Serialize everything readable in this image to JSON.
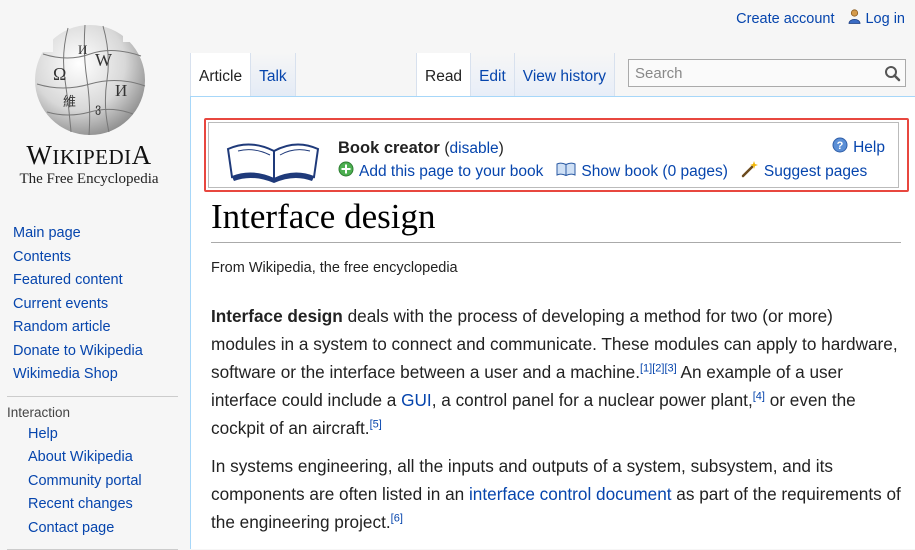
{
  "personal": {
    "create_account": "Create account",
    "login": "Log in"
  },
  "logo": {
    "wordmark_first": "W",
    "wordmark_rest": "IKIPEDI",
    "wordmark_last": "A",
    "tagline": "The Free Encyclopedia"
  },
  "sidebar": {
    "main_items": [
      {
        "label": "Main page"
      },
      {
        "label": "Contents"
      },
      {
        "label": "Featured content"
      },
      {
        "label": "Current events"
      },
      {
        "label": "Random article"
      },
      {
        "label": "Donate to Wikipedia"
      },
      {
        "label": "Wikimedia Shop"
      }
    ],
    "interaction_heading": "Interaction",
    "interaction_items": [
      {
        "label": "Help"
      },
      {
        "label": "About Wikipedia"
      },
      {
        "label": "Community portal"
      },
      {
        "label": "Recent changes"
      },
      {
        "label": "Contact page"
      }
    ]
  },
  "tabs": {
    "article": "Article",
    "talk": "Talk",
    "read": "Read",
    "edit": "Edit",
    "view_history": "View history"
  },
  "search": {
    "placeholder": "Search"
  },
  "book_creator": {
    "title": "Book creator",
    "disable_open": "(",
    "disable": "disable",
    "disable_close": ")",
    "help": "Help",
    "add_page": "Add this page to your book",
    "show_book": "Show book (0 pages)",
    "suggest": "Suggest pages"
  },
  "article": {
    "title": "Interface design",
    "tagline": "From Wikipedia, the free encyclopedia",
    "p1": {
      "bold": "Interface design",
      "t1": " deals with the process of developing a method for two (or more) modules in a system to connect and communicate. These modules can apply to hardware, software or the interface between a user and a machine.",
      "ref1": "[1]",
      "ref2": "[2]",
      "ref3": "[3]",
      "t2": " An example of a user interface could include a ",
      "gui": "GUI",
      "t3": ", a control panel for a nuclear power plant,",
      "ref4": "[4]",
      "t4": " or even the cockpit of an aircraft.",
      "ref5": "[5]"
    },
    "p2": {
      "t1": "In systems engineering, all the inputs and outputs of a system, subsystem, and its components are often listed in an ",
      "icd": "interface control document",
      "t2": " as part of the requirements of the engineering project.",
      "ref6": "[6]"
    }
  },
  "colors": {
    "link": "#0645ad",
    "highlight_border": "#e8473f"
  }
}
